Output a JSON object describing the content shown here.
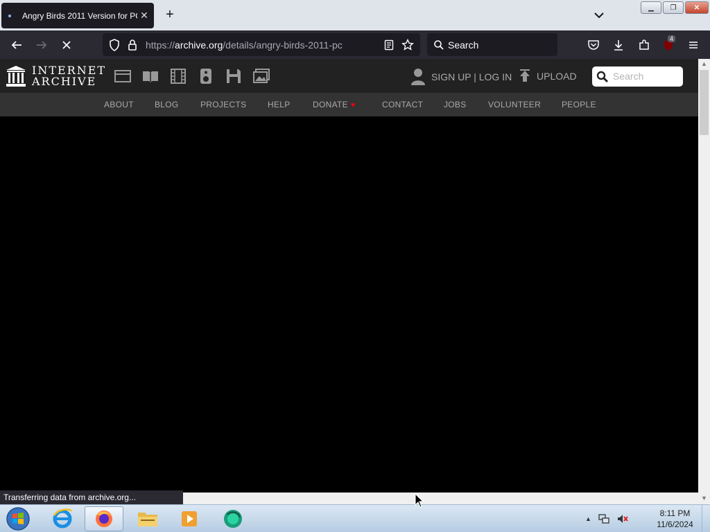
{
  "browser": {
    "tab_title": "Angry Birds 2011 Version for PC",
    "url_scheme": "https://",
    "url_host": "archive.org",
    "url_path": "/details/angry-birds-2011-pc",
    "search_placeholder": "Search",
    "extension_badge": "4",
    "status_text": "Transferring data from archive.org..."
  },
  "ia": {
    "logo_line1": "INTERNET",
    "logo_line2": "ARCHIVE",
    "signup_login": "SIGN UP | LOG IN",
    "upload": "UPLOAD",
    "search_placeholder": "Search",
    "nav": [
      "ABOUT",
      "BLOG",
      "PROJECTS",
      "HELP",
      "DONATE",
      "CONTACT",
      "JOBS",
      "VOLUNTEER",
      "PEOPLE"
    ]
  },
  "taskbar": {
    "time": "8:11 PM",
    "date": "11/6/2024"
  },
  "colors": {
    "tab_bg": "#1c1b22",
    "toolbar_bg": "#2b2a33",
    "ia_header_bg": "#222222",
    "ia_nav_bg": "#333333",
    "donate_heart": "#ee1111"
  }
}
